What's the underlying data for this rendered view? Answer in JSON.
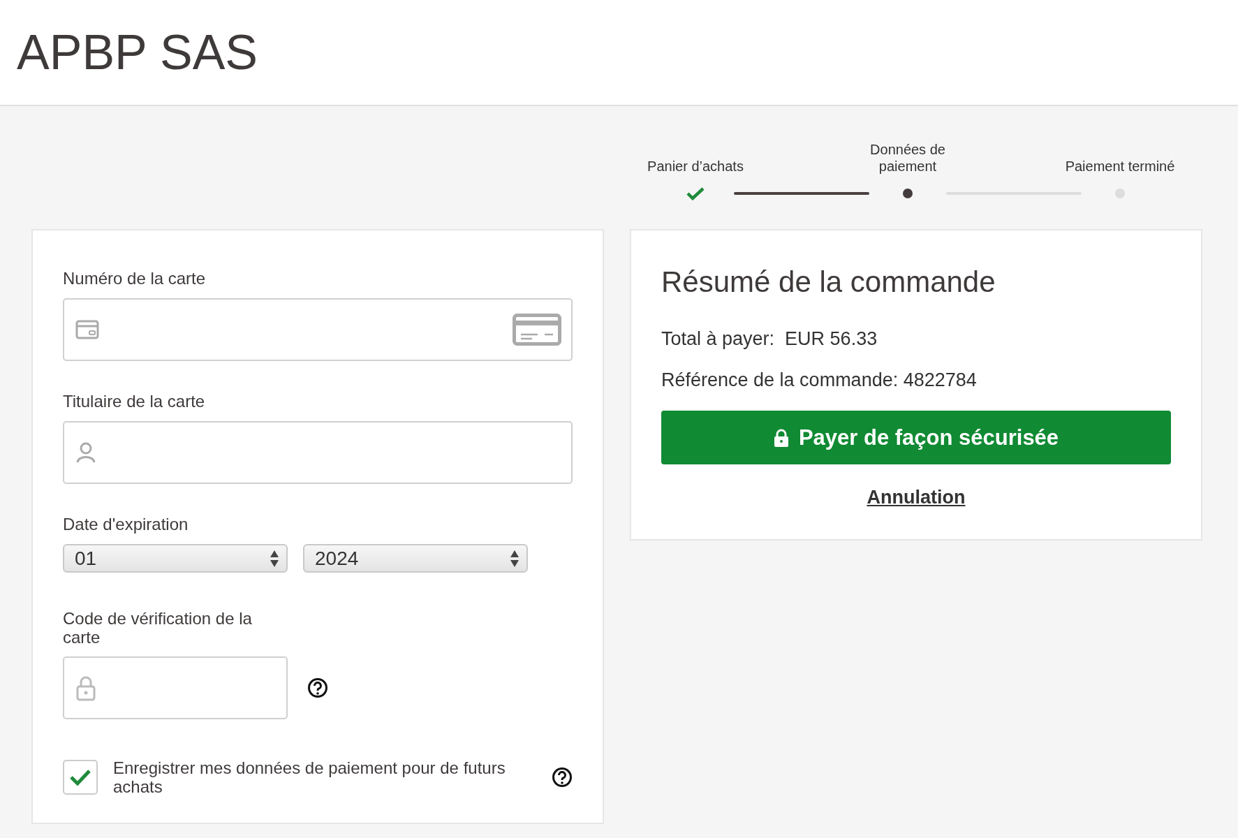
{
  "header": {
    "title": "APBP SAS"
  },
  "steps": [
    {
      "label": "Panier d’achats",
      "completed": true
    },
    {
      "label": "Données de paiement",
      "completed": false
    },
    {
      "label": "Paiement terminé",
      "completed": false
    }
  ],
  "form": {
    "fields": [
      {
        "kind": "card_number",
        "label": "Numéro de la carte"
      },
      {
        "kind": "holder",
        "label": "Titulaire de la carte"
      }
    ],
    "expiry": {
      "label": "Date d'expiration",
      "month": "01",
      "year": "2024"
    },
    "cvv": {
      "label": "Code de vérification de la carte"
    },
    "save": {
      "label": "Enregistrer mes données de paiement pour de futurs achats",
      "checked": true
    }
  },
  "summary": {
    "title": "Résumé de la commande",
    "total": "Total à payer:  EUR 56.33",
    "reference": "Référence de la commande: 4822784",
    "pay_button": "Payer de façon sécurisée",
    "cancel_link": "Annulation"
  }
}
